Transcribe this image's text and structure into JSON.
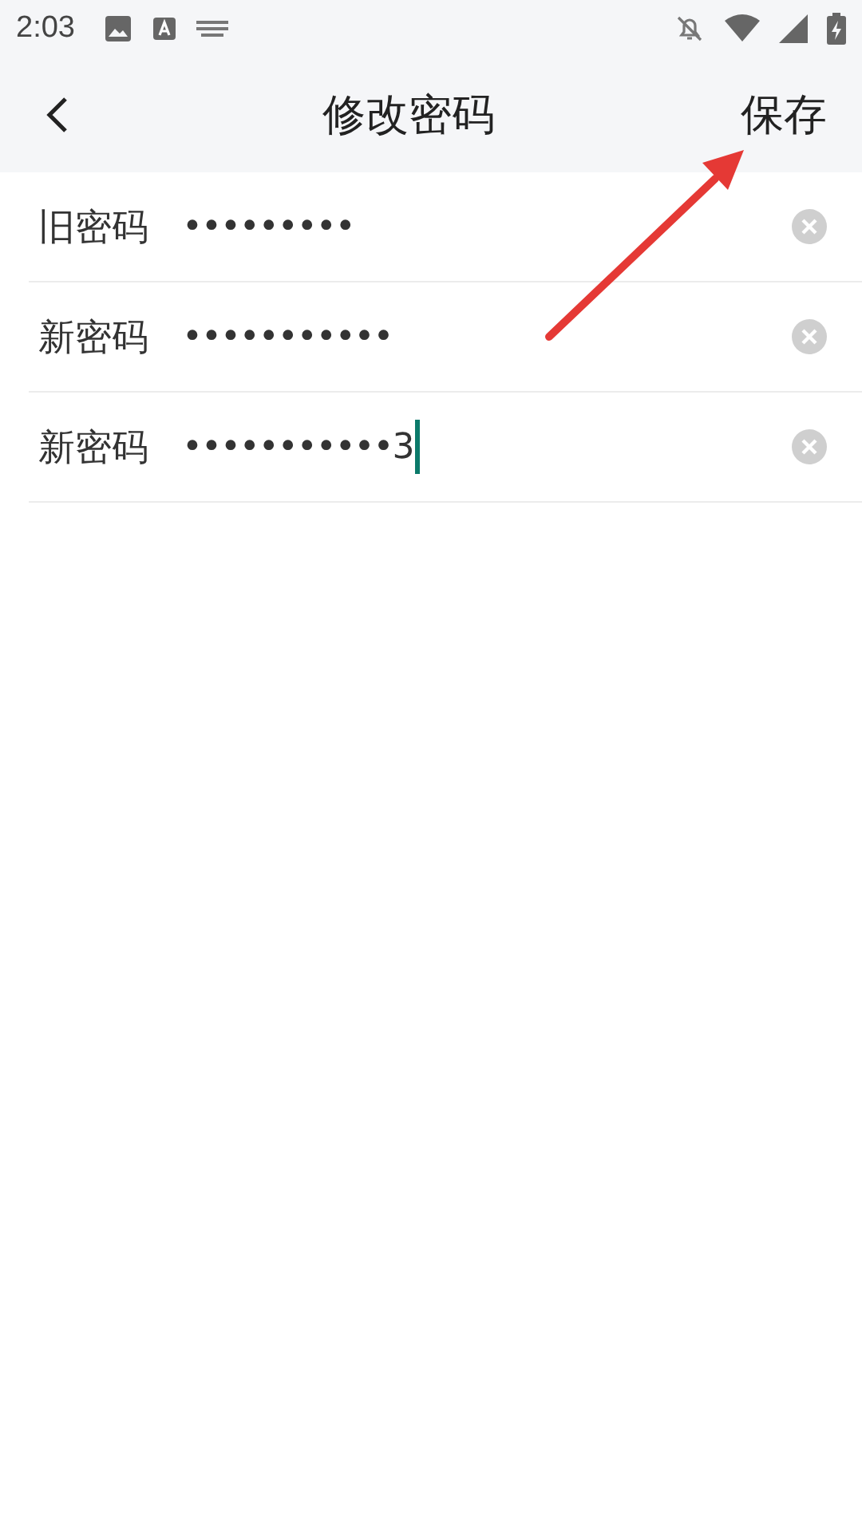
{
  "status_bar": {
    "time": "2:03"
  },
  "header": {
    "title": "修改密码",
    "action": "保存"
  },
  "fields": [
    {
      "label": "旧密码",
      "value": "•••••••••",
      "focused": false
    },
    {
      "label": "新密码",
      "value": "•••••••••••",
      "focused": false
    },
    {
      "label": "新密码",
      "value": "•••••••••••3",
      "focused": true
    }
  ]
}
